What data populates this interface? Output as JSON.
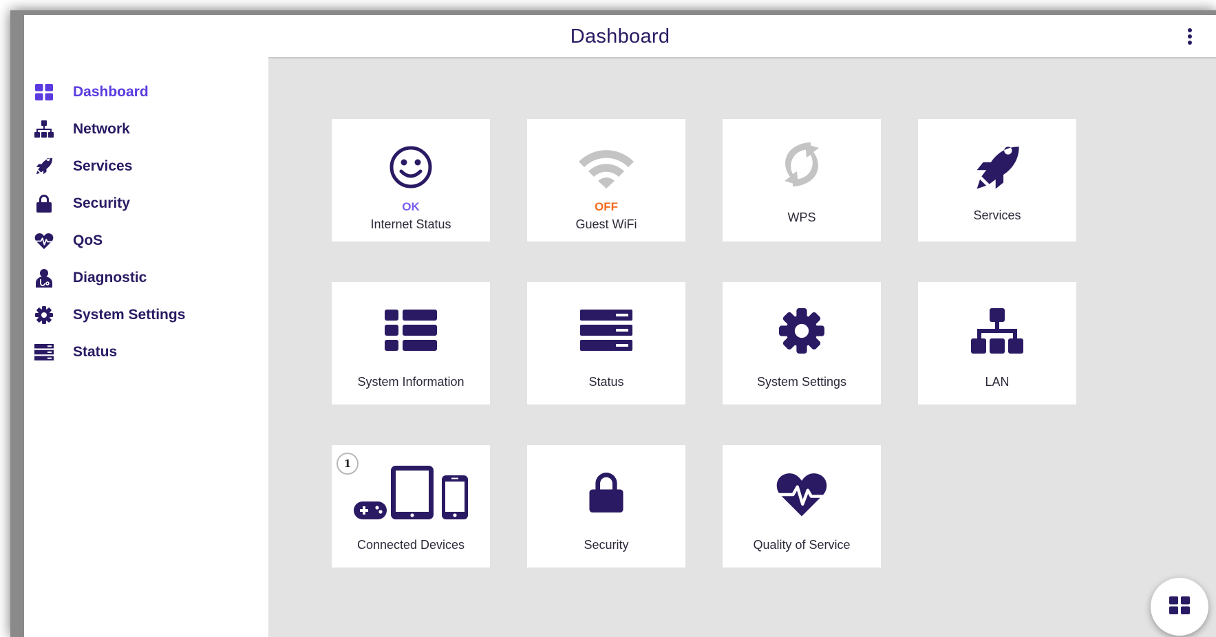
{
  "header": {
    "title": "Dashboard",
    "menu_icon": "more-vert-icon"
  },
  "colors": {
    "primary": "#2a1a63",
    "active": "#5b3be0",
    "ok": "#7a5cf0",
    "off": "#f26b1d",
    "disabled": "#bdbdbd",
    "content_bg": "#e3e3e3"
  },
  "sidebar": {
    "items": [
      {
        "label": "Dashboard",
        "icon": "dashboard-icon",
        "active": true
      },
      {
        "label": "Network",
        "icon": "network-icon"
      },
      {
        "label": "Services",
        "icon": "rocket-icon"
      },
      {
        "label": "Security",
        "icon": "lock-icon"
      },
      {
        "label": "QoS",
        "icon": "heart-pulse-icon"
      },
      {
        "label": "Diagnostic",
        "icon": "doctor-icon"
      },
      {
        "label": "System Settings",
        "icon": "gear-icon"
      },
      {
        "label": "Status",
        "icon": "server-icon"
      }
    ]
  },
  "tiles": [
    {
      "label": "Internet Status",
      "status": "OK",
      "icon": "smiley-icon"
    },
    {
      "label": "Guest WiFi",
      "status": "OFF",
      "icon": "wifi-icon"
    },
    {
      "label": "WPS",
      "icon": "wps-icon"
    },
    {
      "label": "Services",
      "icon": "rocket-icon"
    },
    {
      "label": "System Information",
      "icon": "list-icon"
    },
    {
      "label": "Status",
      "icon": "server-icon"
    },
    {
      "label": "System Settings",
      "icon": "gear-icon"
    },
    {
      "label": "LAN",
      "icon": "network-icon"
    },
    {
      "label": "Connected Devices",
      "icon": "devices-icon",
      "badge": "1"
    },
    {
      "label": "Security",
      "icon": "lock-icon"
    },
    {
      "label": "Quality of Service",
      "icon": "heart-pulse-icon"
    }
  ],
  "fab": {
    "icon": "dashboard-icon"
  }
}
